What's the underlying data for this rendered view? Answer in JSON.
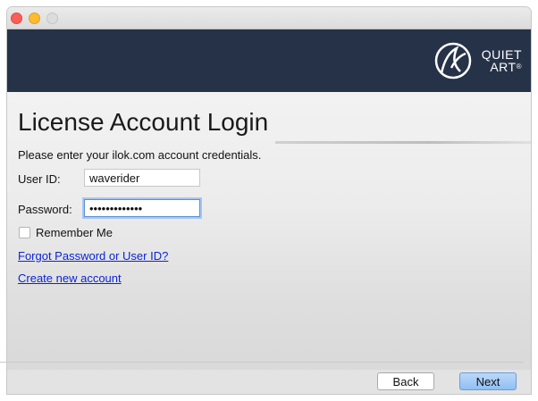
{
  "window": {
    "controls": [
      "close",
      "minimize",
      "maximize"
    ]
  },
  "header": {
    "logo_line1": "QUIET",
    "logo_line2": "ART",
    "logo_mark": "®",
    "background_color": "#263248"
  },
  "main": {
    "title": "License Account Login",
    "instruction": "Please enter your ilok.com account credentials.",
    "user_id_label": "User ID:",
    "user_id_value": "waverider",
    "password_label": "Password:",
    "password_value": "•••••••••••••",
    "remember_label": "Remember Me",
    "remember_checked": false,
    "forgot_link": "Forgot Password or User ID?",
    "create_link": "Create new account"
  },
  "footer": {
    "back_label": "Back",
    "next_label": "Next"
  },
  "colors": {
    "link": "#0b24d6",
    "accent": "#8ec0f4"
  }
}
